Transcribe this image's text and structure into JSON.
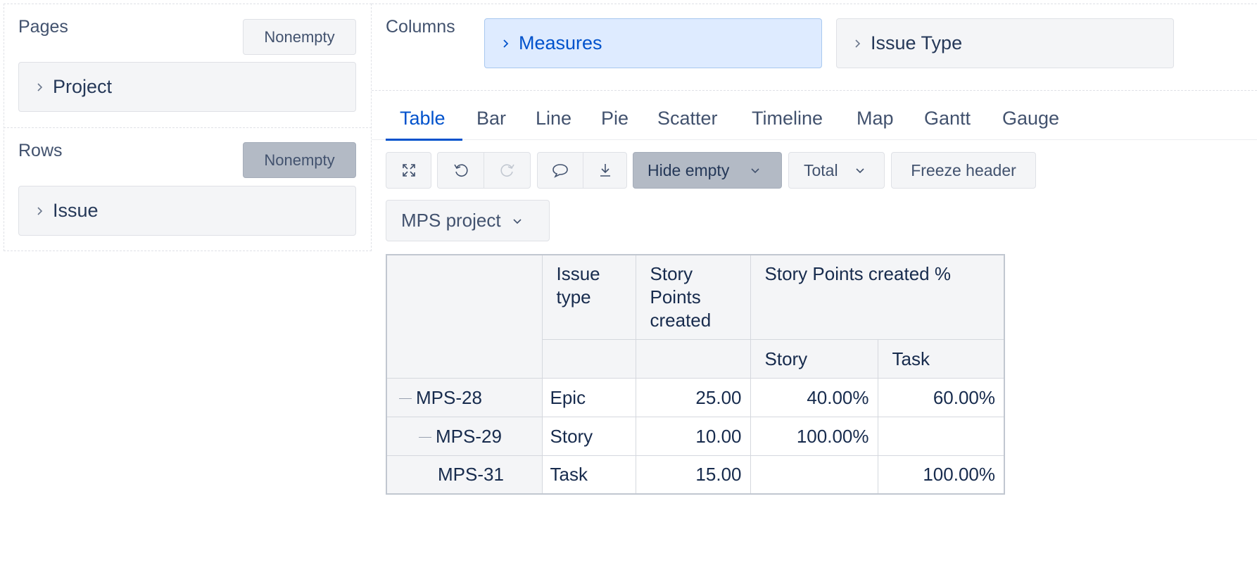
{
  "pages": {
    "title": "Pages",
    "nonempty_label": "Nonempty",
    "dimension": "Project"
  },
  "rows": {
    "title": "Rows",
    "nonempty_label": "Nonempty",
    "dimension": "Issue"
  },
  "columns": {
    "title": "Columns",
    "dimensions": [
      "Measures",
      "Issue Type"
    ]
  },
  "tabs": [
    "Table",
    "Bar",
    "Line",
    "Pie",
    "Scatter",
    "Timeline",
    "Map",
    "Gantt",
    "Gauge"
  ],
  "active_tab": "Table",
  "toolbar": {
    "hide_empty_label": "Hide empty",
    "total_label": "Total",
    "freeze_header_label": "Freeze header",
    "page_filter_label": "MPS project"
  },
  "table": {
    "headers": {
      "issue_type": "Issue type",
      "story_points_created": "Story Points created",
      "story_points_created_pct": "Story Points created %",
      "story": "Story",
      "task": "Task"
    },
    "rows": [
      {
        "key": "MPS-28",
        "type": "Epic",
        "created": "25.00",
        "story_pct": "40.00%",
        "task_pct": "60.00%"
      },
      {
        "key": "MPS-29",
        "type": "Story",
        "created": "10.00",
        "story_pct": "100.00%",
        "task_pct": ""
      },
      {
        "key": "MPS-31",
        "type": "Task",
        "created": "15.00",
        "story_pct": "",
        "task_pct": "100.00%"
      }
    ]
  },
  "colors": {
    "accent": "#0052cc",
    "selected_bg": "#deebff",
    "button_bg": "#f4f5f7",
    "active_button_bg": "#b3bac5"
  }
}
